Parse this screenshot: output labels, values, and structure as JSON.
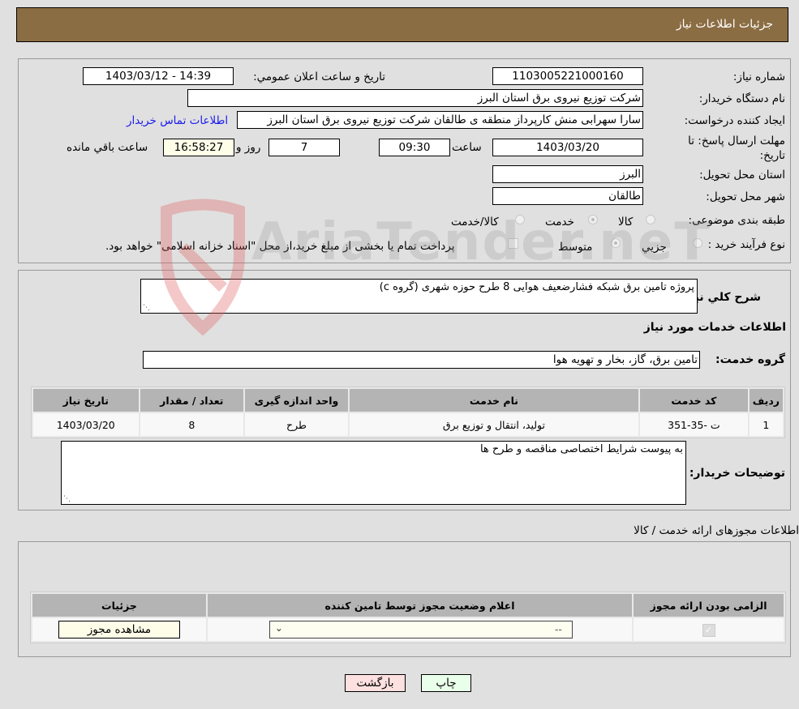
{
  "header": {
    "title": "جزئیات اطلاعات نیاز"
  },
  "form": {
    "need_number_label": "شماره نیاز:",
    "need_number": "1103005221000160",
    "announce_label": "تاریخ و ساعت اعلان عمومي:",
    "announce_value": "1403/03/12 - 14:39",
    "buyer_org_label": "نام دستگاه خریدار:",
    "buyer_org": "شرکت توزیع نیروی برق استان البرز",
    "creator_label": "ایجاد کننده درخواست:",
    "creator": "سارا سهرابی منش کارپرداز منطقه ی طالقان شرکت توزیع نیروی برق استان البرز",
    "contact_link": "اطلاعات تماس خریدار",
    "deadline_label": "مهلت ارسال پاسخ: تا تاریخ:",
    "deadline_date": "1403/03/20",
    "time_label": "ساعت",
    "deadline_time": "09:30",
    "days_value": "7",
    "days_label": "روز و",
    "remaining_time": "16:58:27",
    "remaining_label": "ساعت باقي مانده",
    "province_label": "استان محل تحویل:",
    "province": "البرز",
    "city_label": "شهر محل تحویل:",
    "city": "طالقان",
    "category_label": "طبقه بندی موضوعی:",
    "category_options": [
      "کالا",
      "خدمت",
      "کالا/خدمت"
    ],
    "category_selected": "خدمت",
    "process_label": "نوع فرآیند خرید :",
    "process_options": [
      "جزيي",
      "متوسط"
    ],
    "process_selected": "متوسط",
    "treasury_note": "پرداخت تمام یا بخشی از مبلغ خرید،از محل \"اسناد خزانه اسلامی\" خواهد بود."
  },
  "description": {
    "label": "شرح کلي نیاز:",
    "value": "پروژه تامین برق شبکه فشارضعیف هوایی 8 طرح حوزه شهری (گروه c)"
  },
  "services": {
    "section_title": "اطلاعات خدمات مورد نیاز",
    "group_label": "گروه خدمت:",
    "group_value": "تامین برق، گاز، بخار و تهویه هوا",
    "columns": [
      "ردیف",
      "کد خدمت",
      "نام خدمت",
      "واحد اندازه گیری",
      "تعداد / مقدار",
      "تاریخ نیاز"
    ],
    "rows": [
      [
        "1",
        "ت -35-351",
        "تولید، انتقال و توزیع برق",
        "طرح",
        "8",
        "1403/03/20"
      ]
    ]
  },
  "buyer_notes": {
    "label": "توضیحات خریدار:",
    "value": "به پیوست شرایط اختصاصی مناقصه و طرح ها"
  },
  "licenses": {
    "section_title": "اطلاعات مجوزهای ارائه خدمت / کالا",
    "columns": [
      "الزامی بودن ارائه مجوز",
      "اعلام وضعیت مجوز توسط تامین کننده",
      "جزئیات"
    ],
    "row": {
      "required_checked": true,
      "status_value": "--",
      "details_button": "مشاهده مجوز"
    }
  },
  "footer": {
    "print_button": "چاپ",
    "back_button": "بازگشت"
  },
  "watermark": {
    "text": "AriaTender.neT"
  }
}
